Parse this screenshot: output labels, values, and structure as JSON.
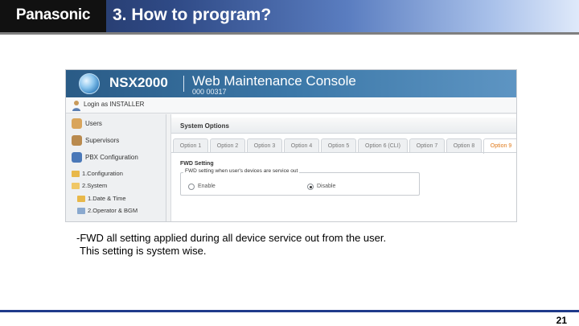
{
  "header": {
    "logo": "Panasonic",
    "title": "3. How to program?"
  },
  "screenshot": {
    "product": "NSX2000",
    "console_title": "Web Maintenance Console",
    "serial": "000 00317",
    "login_label": "Login as INSTALLER",
    "sidebar": {
      "items": [
        {
          "label": "Users"
        },
        {
          "label": "Supervisors"
        },
        {
          "label": "PBX Configuration"
        }
      ],
      "tree": [
        {
          "label": "1.Configuration"
        },
        {
          "label": "2.System"
        },
        {
          "label": "1.Date & Time"
        },
        {
          "label": "2.Operator & BGM"
        }
      ]
    },
    "panel": {
      "title": "System Options",
      "tabs": [
        {
          "label": "Option 1"
        },
        {
          "label": "Option 2"
        },
        {
          "label": "Option 3"
        },
        {
          "label": "Option 4"
        },
        {
          "label": "Option 5"
        },
        {
          "label": "Option 6 (CLI)"
        },
        {
          "label": "Option 7"
        },
        {
          "label": "Option 8"
        },
        {
          "label": "Option 9"
        }
      ],
      "active_tab": "Option 9",
      "section_label": "FWD Setting",
      "group_label": "FWD setting when user's devices are service out",
      "radio_enable": "Enable",
      "radio_disable": "Disable",
      "selected": "Disable"
    }
  },
  "body": {
    "line1": "-FWD all setting applied during all device service out from the user.",
    "line2": "This setting is system wise."
  },
  "footer": {
    "page_number": "21"
  },
  "colors": {
    "header_dark": "#1f2f58",
    "footer_rule": "#1f3a8a",
    "active_tab_text": "#e07a1b"
  }
}
